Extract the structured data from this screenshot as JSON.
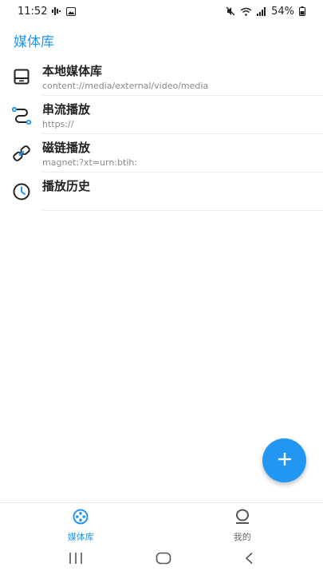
{
  "status_bar": {
    "time": "11:52",
    "battery": "54%",
    "icons": [
      "voice-icon",
      "gallery-icon",
      "mute-icon",
      "wifi-icon",
      "signal-icon",
      "battery-icon"
    ]
  },
  "app": {
    "title": "媒体库",
    "accent_color": "#2196f3"
  },
  "media_list": [
    {
      "icon": "storage-icon",
      "title": "本地媒体库",
      "subtitle": "content://media/external/video/media"
    },
    {
      "icon": "stream-icon",
      "title": "串流播放",
      "subtitle": "https://"
    },
    {
      "icon": "magnet-link-icon",
      "title": "磁链播放",
      "subtitle": "magnet:?xt=urn:btih:"
    },
    {
      "icon": "history-icon",
      "title": "播放历史",
      "subtitle": ""
    }
  ],
  "fab": {
    "icon": "plus-icon"
  },
  "bottom_nav": [
    {
      "label": "媒体库",
      "icon": "film-reel-icon",
      "active": true
    },
    {
      "label": "我的",
      "icon": "profile-icon",
      "active": false
    }
  ],
  "system_nav": [
    "recents-icon",
    "home-icon",
    "back-icon"
  ]
}
